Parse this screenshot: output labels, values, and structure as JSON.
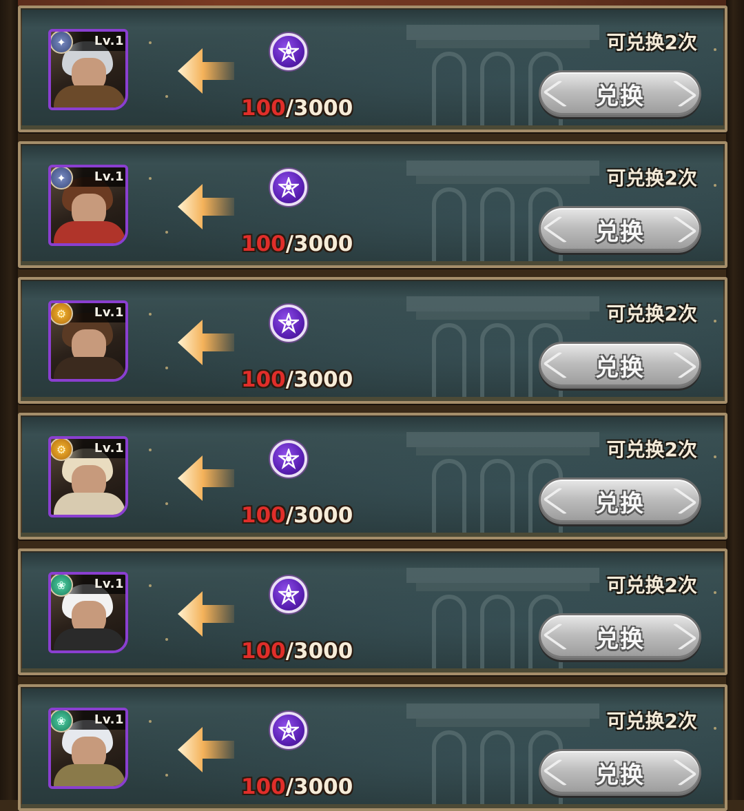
{
  "exchange_list": [
    {
      "hero": {
        "level": "Lv.1",
        "faction": "light",
        "faction_icon": "sun-star-icon",
        "hair": "#cfd3d8",
        "body": "#6b4a2a"
      },
      "progress": {
        "current": "100",
        "separator": "/",
        "required": "3000"
      },
      "remaining": "可兑换2次",
      "button_label": "兑换"
    },
    {
      "hero": {
        "level": "Lv.1",
        "faction": "light",
        "faction_icon": "sun-star-icon",
        "hair": "#6b3b22",
        "body": "#b0342a"
      },
      "progress": {
        "current": "100",
        "separator": "/",
        "required": "3000"
      },
      "remaining": "可兑换2次",
      "button_label": "兑换"
    },
    {
      "hero": {
        "level": "Lv.1",
        "faction": "gold",
        "faction_icon": "gear-emblem-icon",
        "hair": "#5a3a24",
        "body": "#3b2a1e"
      },
      "progress": {
        "current": "100",
        "separator": "/",
        "required": "3000"
      },
      "remaining": "可兑换2次",
      "button_label": "兑换"
    },
    {
      "hero": {
        "level": "Lv.1",
        "faction": "gold",
        "faction_icon": "gear-emblem-icon",
        "hair": "#e9dcc0",
        "body": "#d8cbb0"
      },
      "progress": {
        "current": "100",
        "separator": "/",
        "required": "3000"
      },
      "remaining": "可兑换2次",
      "button_label": "兑换"
    },
    {
      "hero": {
        "level": "Lv.1",
        "faction": "wild",
        "faction_icon": "leaf-emblem-icon",
        "hair": "#f2f2f2",
        "body": "#2a2a2a"
      },
      "progress": {
        "current": "100",
        "separator": "/",
        "required": "3000"
      },
      "remaining": "可兑换2次",
      "button_label": "兑换"
    },
    {
      "hero": {
        "level": "Lv.1",
        "faction": "wild",
        "faction_icon": "leaf-emblem-icon",
        "hair": "#e6e9ee",
        "body": "#8a7a4a"
      },
      "progress": {
        "current": "100",
        "separator": "/",
        "required": "3000"
      },
      "remaining": "可兑换2次",
      "button_label": "兑换"
    }
  ],
  "colors": {
    "progress_current": "#e02e2a",
    "progress_total": "#f6ecd8",
    "stone_purple": "#6a2cc8",
    "frame_gold": "#a58e6a",
    "arrow_orange": "#f2a54a"
  }
}
